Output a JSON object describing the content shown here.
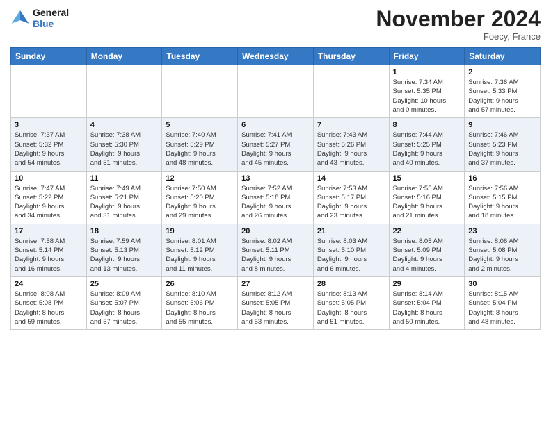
{
  "header": {
    "logo_line1": "General",
    "logo_line2": "Blue",
    "month": "November 2024",
    "location": "Foecy, France"
  },
  "weekdays": [
    "Sunday",
    "Monday",
    "Tuesday",
    "Wednesday",
    "Thursday",
    "Friday",
    "Saturday"
  ],
  "weeks": [
    [
      {
        "day": "",
        "info": ""
      },
      {
        "day": "",
        "info": ""
      },
      {
        "day": "",
        "info": ""
      },
      {
        "day": "",
        "info": ""
      },
      {
        "day": "",
        "info": ""
      },
      {
        "day": "1",
        "info": "Sunrise: 7:34 AM\nSunset: 5:35 PM\nDaylight: 10 hours\nand 0 minutes."
      },
      {
        "day": "2",
        "info": "Sunrise: 7:36 AM\nSunset: 5:33 PM\nDaylight: 9 hours\nand 57 minutes."
      }
    ],
    [
      {
        "day": "3",
        "info": "Sunrise: 7:37 AM\nSunset: 5:32 PM\nDaylight: 9 hours\nand 54 minutes."
      },
      {
        "day": "4",
        "info": "Sunrise: 7:38 AM\nSunset: 5:30 PM\nDaylight: 9 hours\nand 51 minutes."
      },
      {
        "day": "5",
        "info": "Sunrise: 7:40 AM\nSunset: 5:29 PM\nDaylight: 9 hours\nand 48 minutes."
      },
      {
        "day": "6",
        "info": "Sunrise: 7:41 AM\nSunset: 5:27 PM\nDaylight: 9 hours\nand 45 minutes."
      },
      {
        "day": "7",
        "info": "Sunrise: 7:43 AM\nSunset: 5:26 PM\nDaylight: 9 hours\nand 43 minutes."
      },
      {
        "day": "8",
        "info": "Sunrise: 7:44 AM\nSunset: 5:25 PM\nDaylight: 9 hours\nand 40 minutes."
      },
      {
        "day": "9",
        "info": "Sunrise: 7:46 AM\nSunset: 5:23 PM\nDaylight: 9 hours\nand 37 minutes."
      }
    ],
    [
      {
        "day": "10",
        "info": "Sunrise: 7:47 AM\nSunset: 5:22 PM\nDaylight: 9 hours\nand 34 minutes."
      },
      {
        "day": "11",
        "info": "Sunrise: 7:49 AM\nSunset: 5:21 PM\nDaylight: 9 hours\nand 31 minutes."
      },
      {
        "day": "12",
        "info": "Sunrise: 7:50 AM\nSunset: 5:20 PM\nDaylight: 9 hours\nand 29 minutes."
      },
      {
        "day": "13",
        "info": "Sunrise: 7:52 AM\nSunset: 5:18 PM\nDaylight: 9 hours\nand 26 minutes."
      },
      {
        "day": "14",
        "info": "Sunrise: 7:53 AM\nSunset: 5:17 PM\nDaylight: 9 hours\nand 23 minutes."
      },
      {
        "day": "15",
        "info": "Sunrise: 7:55 AM\nSunset: 5:16 PM\nDaylight: 9 hours\nand 21 minutes."
      },
      {
        "day": "16",
        "info": "Sunrise: 7:56 AM\nSunset: 5:15 PM\nDaylight: 9 hours\nand 18 minutes."
      }
    ],
    [
      {
        "day": "17",
        "info": "Sunrise: 7:58 AM\nSunset: 5:14 PM\nDaylight: 9 hours\nand 16 minutes."
      },
      {
        "day": "18",
        "info": "Sunrise: 7:59 AM\nSunset: 5:13 PM\nDaylight: 9 hours\nand 13 minutes."
      },
      {
        "day": "19",
        "info": "Sunrise: 8:01 AM\nSunset: 5:12 PM\nDaylight: 9 hours\nand 11 minutes."
      },
      {
        "day": "20",
        "info": "Sunrise: 8:02 AM\nSunset: 5:11 PM\nDaylight: 9 hours\nand 8 minutes."
      },
      {
        "day": "21",
        "info": "Sunrise: 8:03 AM\nSunset: 5:10 PM\nDaylight: 9 hours\nand 6 minutes."
      },
      {
        "day": "22",
        "info": "Sunrise: 8:05 AM\nSunset: 5:09 PM\nDaylight: 9 hours\nand 4 minutes."
      },
      {
        "day": "23",
        "info": "Sunrise: 8:06 AM\nSunset: 5:08 PM\nDaylight: 9 hours\nand 2 minutes."
      }
    ],
    [
      {
        "day": "24",
        "info": "Sunrise: 8:08 AM\nSunset: 5:08 PM\nDaylight: 8 hours\nand 59 minutes."
      },
      {
        "day": "25",
        "info": "Sunrise: 8:09 AM\nSunset: 5:07 PM\nDaylight: 8 hours\nand 57 minutes."
      },
      {
        "day": "26",
        "info": "Sunrise: 8:10 AM\nSunset: 5:06 PM\nDaylight: 8 hours\nand 55 minutes."
      },
      {
        "day": "27",
        "info": "Sunrise: 8:12 AM\nSunset: 5:05 PM\nDaylight: 8 hours\nand 53 minutes."
      },
      {
        "day": "28",
        "info": "Sunrise: 8:13 AM\nSunset: 5:05 PM\nDaylight: 8 hours\nand 51 minutes."
      },
      {
        "day": "29",
        "info": "Sunrise: 8:14 AM\nSunset: 5:04 PM\nDaylight: 8 hours\nand 50 minutes."
      },
      {
        "day": "30",
        "info": "Sunrise: 8:15 AM\nSunset: 5:04 PM\nDaylight: 8 hours\nand 48 minutes."
      }
    ]
  ]
}
